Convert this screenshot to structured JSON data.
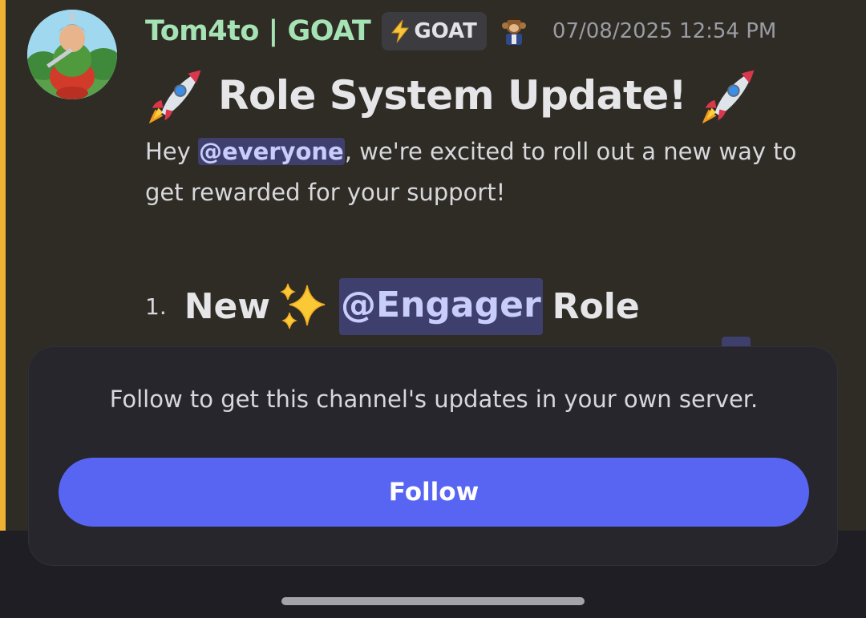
{
  "message": {
    "author": "Tom4to | GOAT",
    "tag": {
      "icon": "lightning-bolt-icon",
      "label": "GOAT"
    },
    "role_icon": "monkey-icon",
    "timestamp": "07/08/2025 12:54 PM",
    "title": "Role System Update!",
    "title_emoji": "rocket-emoji",
    "body": {
      "greeting": "Hey ",
      "mention": "@everyone",
      "rest": ", we're excited to roll out a new way to get rewarded for your support!"
    },
    "list_item": {
      "number": "1.",
      "prefix": "New",
      "emoji": "sparkles-emoji",
      "mention": "@Engager",
      "suffix": "Role"
    }
  },
  "follow_prompt": {
    "text": "Follow to get this channel's updates in your own server.",
    "button_label": "Follow"
  },
  "colors": {
    "accent": "#5865f2",
    "author": "#a6e3b4",
    "mention_bg": "#3e3f6d",
    "mention_fg": "#c9cdfb",
    "highlight_bar": "#f0b232"
  }
}
